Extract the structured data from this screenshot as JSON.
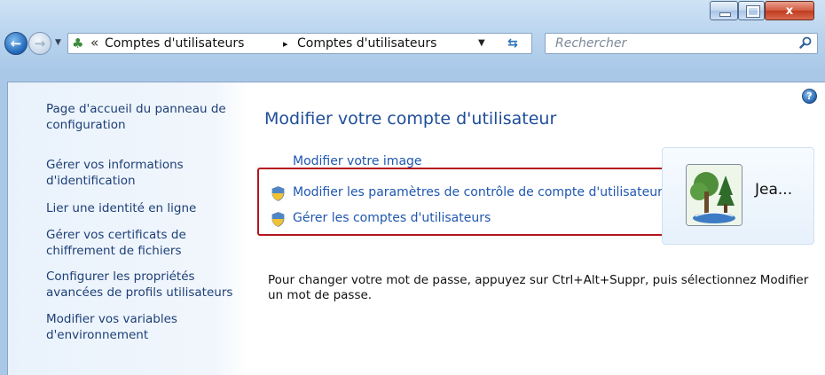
{
  "titlebar": {
    "minimize_icon": "minimize-icon",
    "maximize_icon": "maximize-icon",
    "close_label": "x"
  },
  "nav": {
    "back_icon": "back-arrow-icon",
    "forward_icon": "forward-arrow-icon",
    "breadcrumb": [
      {
        "label": "Comptes d'utilisateurs"
      },
      {
        "label": "Comptes d'utilisateurs"
      }
    ],
    "breadcrumb_prefix": "«",
    "separator": "▸",
    "search_placeholder": "Rechercher"
  },
  "left_pane": {
    "links": [
      {
        "label": "Page d'accueil du panneau de configuration"
      },
      {
        "label": "Gérer vos informations d'identification"
      },
      {
        "label": "Lier une identité en ligne"
      },
      {
        "label": "Gérer vos certificats de chiffrement de fichiers"
      },
      {
        "label": "Configurer les propriétés avancées de profils utilisateurs"
      },
      {
        "label": "Modifier vos variables d'environnement"
      }
    ]
  },
  "main": {
    "title": "Modifier votre compte d'utilisateur",
    "links": [
      {
        "label": "Modifier votre image"
      },
      {
        "label": "Modifier les paramètres de contrôle de compte d'utilisateur"
      },
      {
        "label": "Gérer les comptes d'utilisateurs"
      }
    ],
    "password_note": "Pour changer votre mot de passe, appuyez sur Ctrl+Alt+Suppr, puis sélectionnez Modifier un mot de passe.",
    "help_label": "?"
  },
  "user": {
    "name": "Jea..."
  },
  "colors": {
    "link": "#1f57b0",
    "title": "#1e4d9a",
    "highlight_frame": "#b3161f"
  }
}
